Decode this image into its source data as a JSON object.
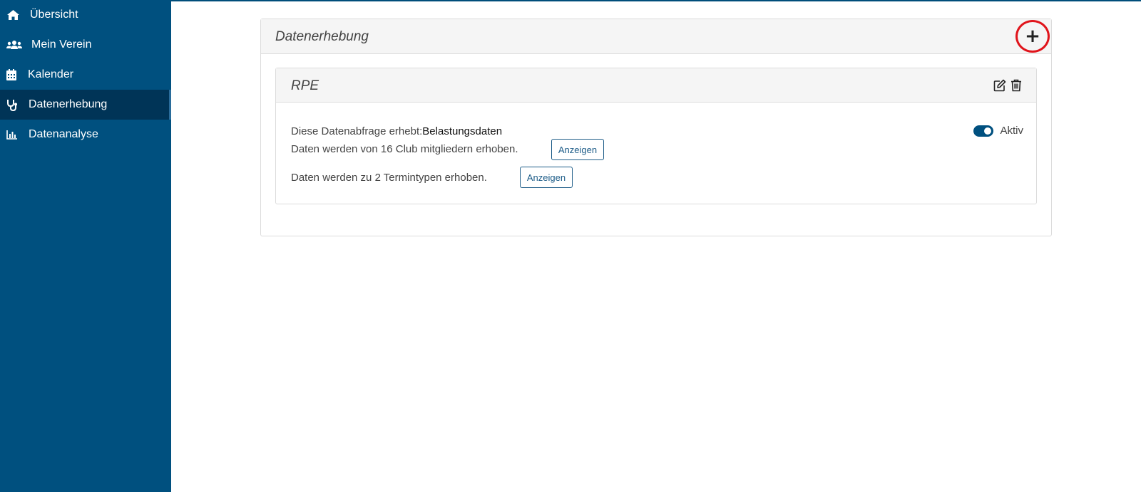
{
  "sidebar": {
    "items": [
      {
        "label": "Übersicht",
        "icon": "home-icon"
      },
      {
        "label": "Mein Verein",
        "icon": "users-icon"
      },
      {
        "label": "Kalender",
        "icon": "calendar-icon"
      },
      {
        "label": "Datenerhebung",
        "icon": "stethoscope-icon",
        "active": true
      },
      {
        "label": "Datenanalyse",
        "icon": "bar-chart-icon"
      }
    ]
  },
  "main": {
    "title": "Datenerhebung",
    "add_icon": "+",
    "survey": {
      "title": "RPE",
      "line1_prefix": "Diese Datenabfrage erhebt:",
      "line1_value": "Belastungsdaten",
      "line2": "Daten werden von 16 Club mitgliedern erhoben.",
      "line3": "Daten werden zu 2 Termintypen erhoben.",
      "show_button": "Anzeigen",
      "status_label": "Aktiv",
      "status_active": true
    }
  },
  "colors": {
    "sidebar_bg": "#00507f",
    "active_bg": "#003457",
    "highlight_circle": "#e0141b"
  }
}
